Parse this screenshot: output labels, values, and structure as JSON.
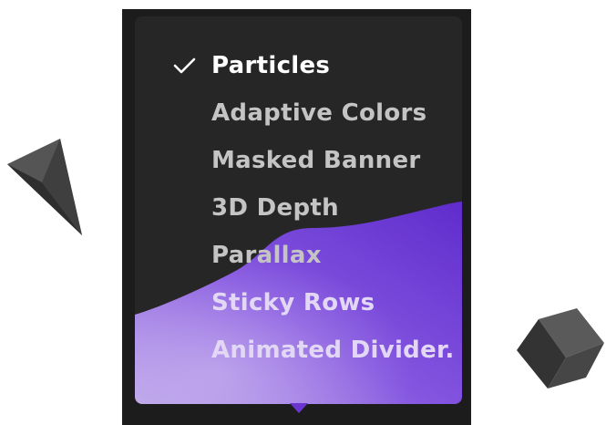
{
  "menu": {
    "selected_index": 0,
    "items": [
      {
        "label": "Particles",
        "selected": true
      },
      {
        "label": "Adaptive Colors",
        "selected": false
      },
      {
        "label": "Masked Banner",
        "selected": false
      },
      {
        "label": "3D Depth",
        "selected": false
      },
      {
        "label": "Parallax",
        "selected": false
      },
      {
        "label": "Sticky Rows",
        "selected": false
      },
      {
        "label": "Animated Divider.",
        "selected": false
      }
    ],
    "check_icon": "checkmark-icon"
  },
  "colors": {
    "backdrop": "#1c1c1c",
    "card": "#262626",
    "selected_text": "#ffffff",
    "item_text": "#c4c4c4",
    "accent_purple": "#6b36cf",
    "accent_lavender": "#b9a0e8"
  },
  "decorations": [
    "pyramid-shape",
    "cube-shape"
  ]
}
